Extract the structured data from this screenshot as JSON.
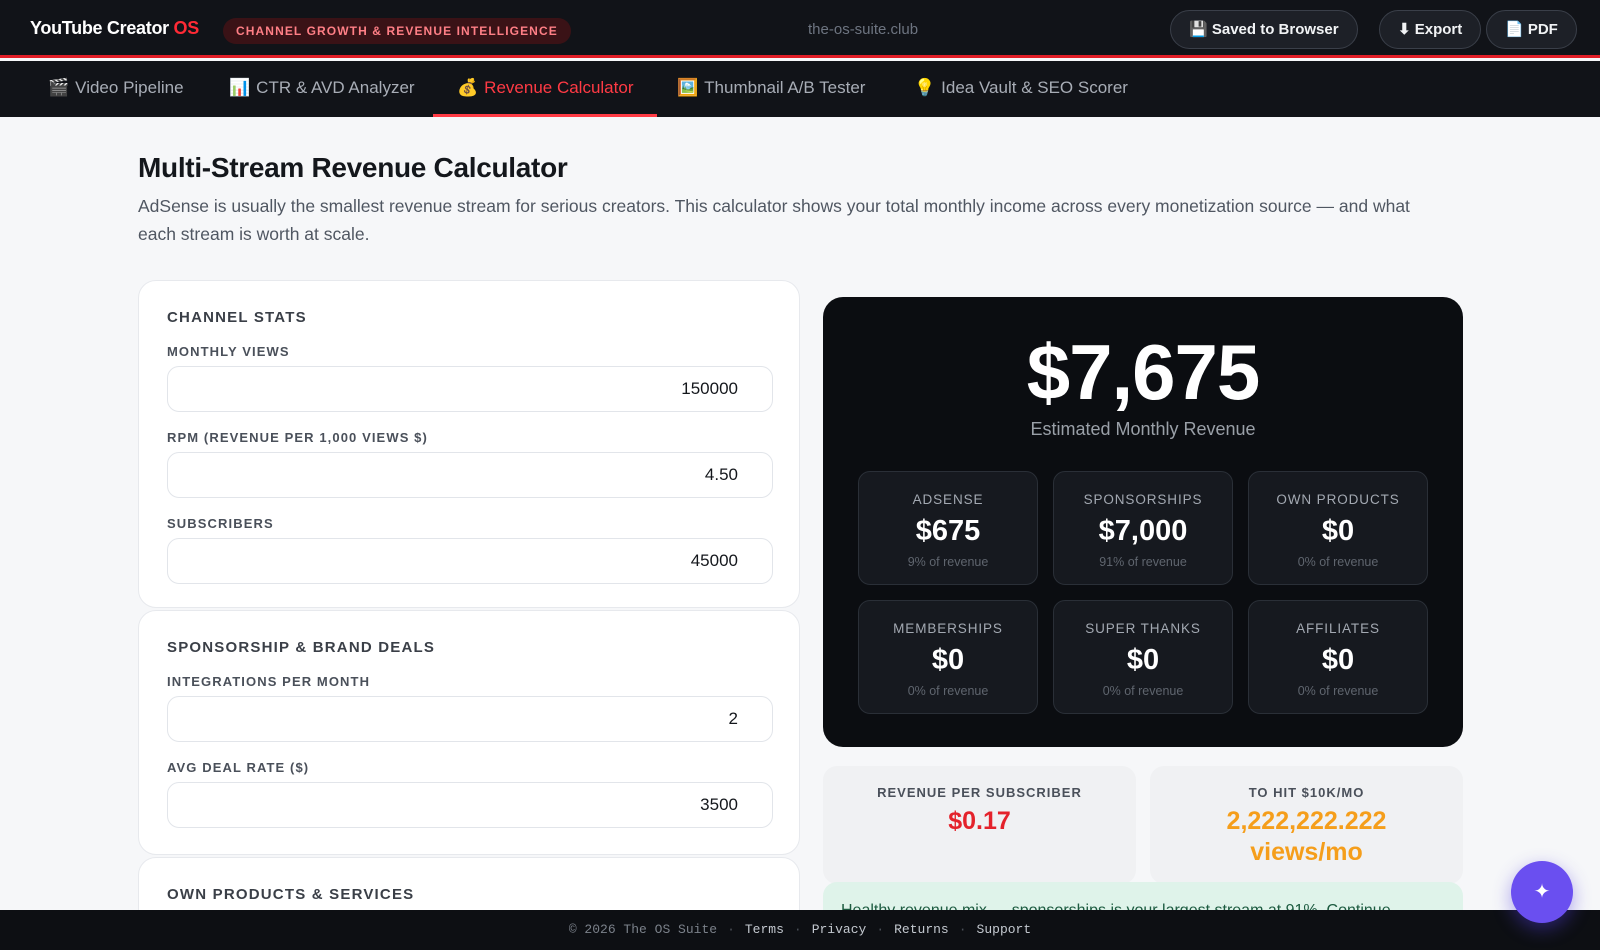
{
  "app": {
    "title_main": "YouTube Creator ",
    "title_accent": "OS",
    "tagline": "CHANNEL GROWTH & REVENUE INTELLIGENCE",
    "domain": "the-os-suite.club"
  },
  "toolbar": {
    "saved": "💾 Saved to Browser",
    "export": "⬇ Export",
    "pdf": "📄 PDF"
  },
  "tabs": [
    {
      "icon": "🎬",
      "label": "Video Pipeline"
    },
    {
      "icon": "📊",
      "label": "CTR & AVD Analyzer"
    },
    {
      "icon": "💰",
      "label": "Revenue Calculator"
    },
    {
      "icon": "🖼️",
      "label": "Thumbnail A/B Tester"
    },
    {
      "icon": "💡",
      "label": "Idea Vault & SEO Scorer"
    }
  ],
  "active_tab": "Revenue Calculator",
  "page": {
    "title": "Multi-Stream Revenue Calculator",
    "intro": "AdSense is usually the smallest revenue stream for serious creators. This calculator shows your total monthly income across every monetization source — and what each stream is worth at scale."
  },
  "channel_stats": {
    "heading": "CHANNEL STATS",
    "views_label": "MONTHLY VIEWS",
    "views": "150000",
    "rpm_label": "RPM (REVENUE PER 1,000 VIEWS $)",
    "rpm": "4.50",
    "subs_label": "SUBSCRIBERS",
    "subs": "45000"
  },
  "sponsorship": {
    "heading": "SPONSORSHIP & BRAND DEALS",
    "integrations_label": "INTEGRATIONS PER MONTH",
    "integrations": "2",
    "rate_label": "AVG DEAL RATE ($)",
    "rate": "3500"
  },
  "products": {
    "heading": "OWN PRODUCTS & SERVICES"
  },
  "summary": {
    "total": "$7,675",
    "total_label": "Estimated Monthly Revenue",
    "streams": [
      {
        "name": "ADSENSE",
        "value": "$675",
        "pct": "9% of revenue"
      },
      {
        "name": "SPONSORSHIPS",
        "value": "$7,000",
        "pct": "91% of revenue"
      },
      {
        "name": "OWN PRODUCTS",
        "value": "$0",
        "pct": "0% of revenue"
      },
      {
        "name": "MEMBERSHIPS",
        "value": "$0",
        "pct": "0% of revenue"
      },
      {
        "name": "SUPER THANKS",
        "value": "$0",
        "pct": "0% of revenue"
      },
      {
        "name": "AFFILIATES",
        "value": "$0",
        "pct": "0% of revenue"
      }
    ]
  },
  "metrics": {
    "rev_per_sub_label": "REVENUE PER SUBSCRIBER",
    "rev_per_sub": "$0.17",
    "to_10k_label": "TO HIT $10K/MO",
    "to_10k": "2,222,222.222",
    "to_10k_unit": "views/mo"
  },
  "insight": "Healthy revenue mix — sponsorships is your largest stream at 91%. Continue",
  "footer": {
    "copyright": "© 2026 The OS Suite",
    "terms": "Terms",
    "privacy": "Privacy",
    "returns": "Returns",
    "support": "Support"
  },
  "fab_icon": "sparkle-icon",
  "colors": {
    "accent": "#ff3a44",
    "orange": "#f59e1b",
    "red_value": "#e4222b",
    "fab": "#6a4ff0"
  }
}
